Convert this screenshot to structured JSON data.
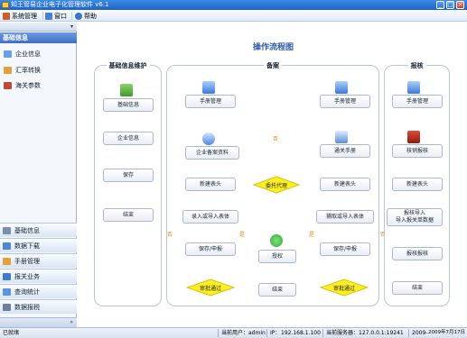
{
  "window": {
    "title": "知王管易企业电子化管理软件 v6.1"
  },
  "menu": [
    {
      "label": "系统管理",
      "icon": "tools-icon"
    },
    {
      "label": "窗口",
      "icon": "window-icon"
    },
    {
      "label": "帮助",
      "icon": "help-icon"
    }
  ],
  "sidebar": {
    "header": "基础信息",
    "items": [
      {
        "label": "企业信息",
        "icon": "building-icon"
      },
      {
        "label": "汇率转换",
        "icon": "exchange-icon"
      },
      {
        "label": "海关参数",
        "icon": "customs-icon"
      }
    ],
    "nav": [
      {
        "label": "基础信息",
        "icon": "info-icon"
      },
      {
        "label": "数据下载",
        "icon": "download-icon"
      },
      {
        "label": "手册管理",
        "icon": "manual-icon"
      },
      {
        "label": "报关业务",
        "icon": "declare-icon"
      },
      {
        "label": "查询统计",
        "icon": "query-icon"
      },
      {
        "label": "数据报税",
        "icon": "tax-icon"
      }
    ]
  },
  "flow": {
    "title": "操作流程图",
    "panels": {
      "basic": "基础信息维护",
      "record": "备案",
      "declare": "报核"
    },
    "basic_steps": [
      "基础信息",
      "企业信息",
      "保存",
      "结束"
    ],
    "record_left": [
      "手册管理",
      "企业备案资料",
      "新建表头",
      "录入或导入表体",
      "保存/申报",
      "审批通过"
    ],
    "record_mid": [
      "委托代理",
      "授权",
      "结束"
    ],
    "record_right": [
      "手册管理",
      "通关手册",
      "新建表头",
      "捕取或导入表体",
      "保存/申报",
      "审批通过"
    ],
    "declare_steps": [
      "手册管理",
      "核销报核",
      "新建表头",
      "报核导入\n导入报关单数据",
      "报核报核",
      "结束"
    ],
    "notes": [
      "否",
      "是",
      "否",
      "是",
      "否"
    ]
  },
  "status": {
    "ready": "已就绪",
    "user_label": "当前用户：",
    "user": "admin",
    "ip_label": "IP：",
    "ip": "192.168.1.100",
    "server_label": "当前服务器：",
    "server": "127.0.0.1:19241",
    "date1": "2009-",
    "date2": "2009年7月17日"
  },
  "colors": {
    "titlebar": "#1f62c8",
    "accent": "#2d5aa8",
    "diamond": "#ffee22",
    "check": "#2fae3a"
  }
}
